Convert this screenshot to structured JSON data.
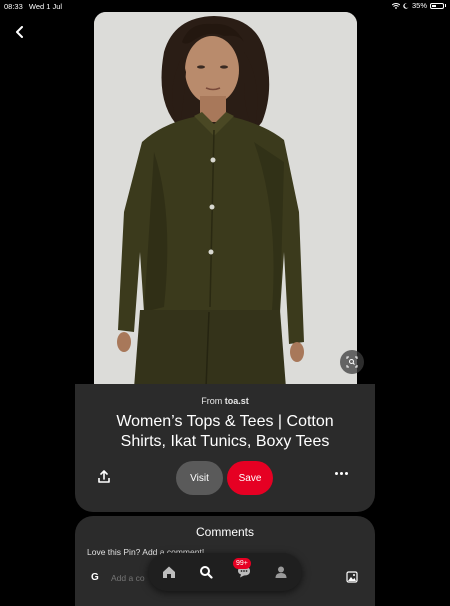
{
  "status_bar": {
    "time": "08:33",
    "date": "Wed 1 Jul",
    "battery": "35%"
  },
  "pin": {
    "source_prefix": "From",
    "source_domain": "toa.st",
    "title": "Women’s Tops & Tees | Cotton Shirts, Ikat Tunics, Boxy Tees",
    "visit_label": "Visit",
    "save_label": "Save"
  },
  "comments": {
    "title": "Comments",
    "prompt": "Love this Pin? Add a comment!",
    "avatar_initial": "G",
    "input_placeholder": "Add a co"
  },
  "nav": {
    "notifications_badge": "99+"
  },
  "colors": {
    "background": "#000000",
    "card": "#2b2b2b",
    "save_red": "#e60023",
    "visit_gray": "#5a5a5a",
    "garment_olive": "#3b3a1c"
  },
  "icons": [
    "back-arrow-icon",
    "visual-search-icon",
    "share-icon",
    "more-icon",
    "home-icon",
    "search-icon",
    "messages-icon",
    "profile-icon",
    "image-picker-icon",
    "wifi-icon",
    "moon-icon",
    "battery-icon"
  ]
}
